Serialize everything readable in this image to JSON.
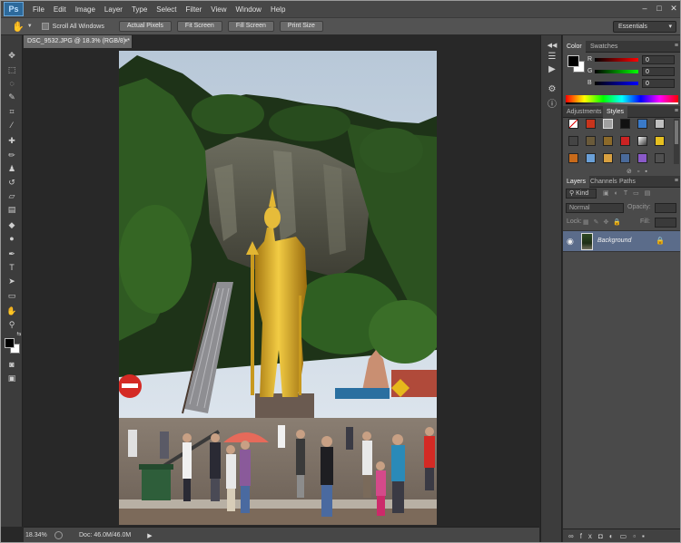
{
  "menubar": {
    "logo": "Ps",
    "items": [
      "File",
      "Edit",
      "Image",
      "Layer",
      "Type",
      "Select",
      "Filter",
      "View",
      "Window",
      "Help"
    ]
  },
  "options": {
    "scroll_all_windows": "Scroll All Windows",
    "buttons": [
      "Actual Pixels",
      "Fit Screen",
      "Fill Screen",
      "Print Size"
    ],
    "workspace": "Essentials"
  },
  "document": {
    "tab_title": "DSC_9532.JPG @ 18.3% (RGB/8) *"
  },
  "statusbar": {
    "zoom": "18.34%",
    "doc_size": "Doc: 46.0M/46.0M"
  },
  "color_panel": {
    "tabs": [
      "Color",
      "Swatches"
    ],
    "channels": [
      {
        "label": "R",
        "value": "0",
        "color": "#ff0000"
      },
      {
        "label": "G",
        "value": "0",
        "color": "#00ff00"
      },
      {
        "label": "B",
        "value": "0",
        "color": "#0000ff"
      }
    ]
  },
  "styles_panel": {
    "tabs": [
      "Adjustments",
      "Styles"
    ]
  },
  "layers_panel": {
    "tabs": [
      "Layers",
      "Channels",
      "Paths"
    ],
    "filter": "Kind",
    "blend_mode": "Normal",
    "opacity_label": "Opacity:",
    "lock_label": "Lock:",
    "fill_label": "Fill:",
    "layer_name": "Background"
  },
  "colors": {
    "chrome": "#474747",
    "panel": "#4a4a4a",
    "canvas_bg": "#282828",
    "layer_selected": "#5b6c8a",
    "statue_gold": "#d4a520"
  }
}
